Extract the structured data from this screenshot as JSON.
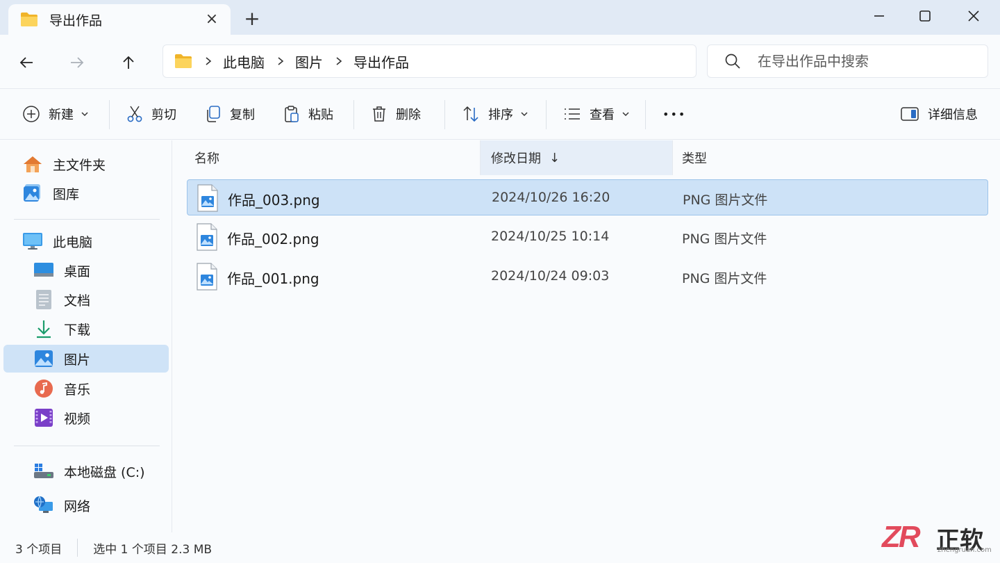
{
  "window": {
    "tab_title": "导出作品",
    "tab_close": "×",
    "new_tab": "+"
  },
  "breadcrumb": [
    "此电脑",
    "图片",
    "导出作品"
  ],
  "search": {
    "placeholder": "在导出作品中搜索"
  },
  "toolbar": {
    "new": "新建",
    "cut": "剪切",
    "copy": "复制",
    "paste": "粘贴",
    "delete": "删除",
    "sort": "排序",
    "view": "查看",
    "more": "•••",
    "details": "详细信息"
  },
  "sidebar": {
    "home": "主文件夹",
    "gallery": "图库",
    "this_pc": "此电脑",
    "desktop": "桌面",
    "documents": "文档",
    "downloads": "下载",
    "pictures": "图片",
    "music": "音乐",
    "videos": "视频",
    "local_disk": "本地磁盘 (C:)",
    "network": "网络"
  },
  "columns": {
    "name": "名称",
    "modified": "修改日期",
    "sort_arrow": "↓",
    "type": "类型"
  },
  "files": [
    {
      "name": "作品_003.png",
      "date": "2024/10/26  16:20",
      "type": "PNG 图片文件",
      "selected": true
    },
    {
      "name": "作品_002.png",
      "date": "2024/10/25  10:14",
      "type": "PNG 图片文件",
      "selected": false
    },
    {
      "name": "作品_001.png",
      "date": "2024/10/24  09:03",
      "type": "PNG 图片文件",
      "selected": false
    }
  ],
  "status": {
    "item_count": "3 个项目",
    "selection": "选中 1 个项目  2.3 MB"
  },
  "watermark": {
    "logo": "ZR",
    "brand": "正软",
    "url": "zhengruan.com"
  },
  "colors": {
    "accent": "#0067c0",
    "selection": "#cde2f7",
    "titlebar": "#e1eaf5",
    "folder": "#f6c644"
  }
}
